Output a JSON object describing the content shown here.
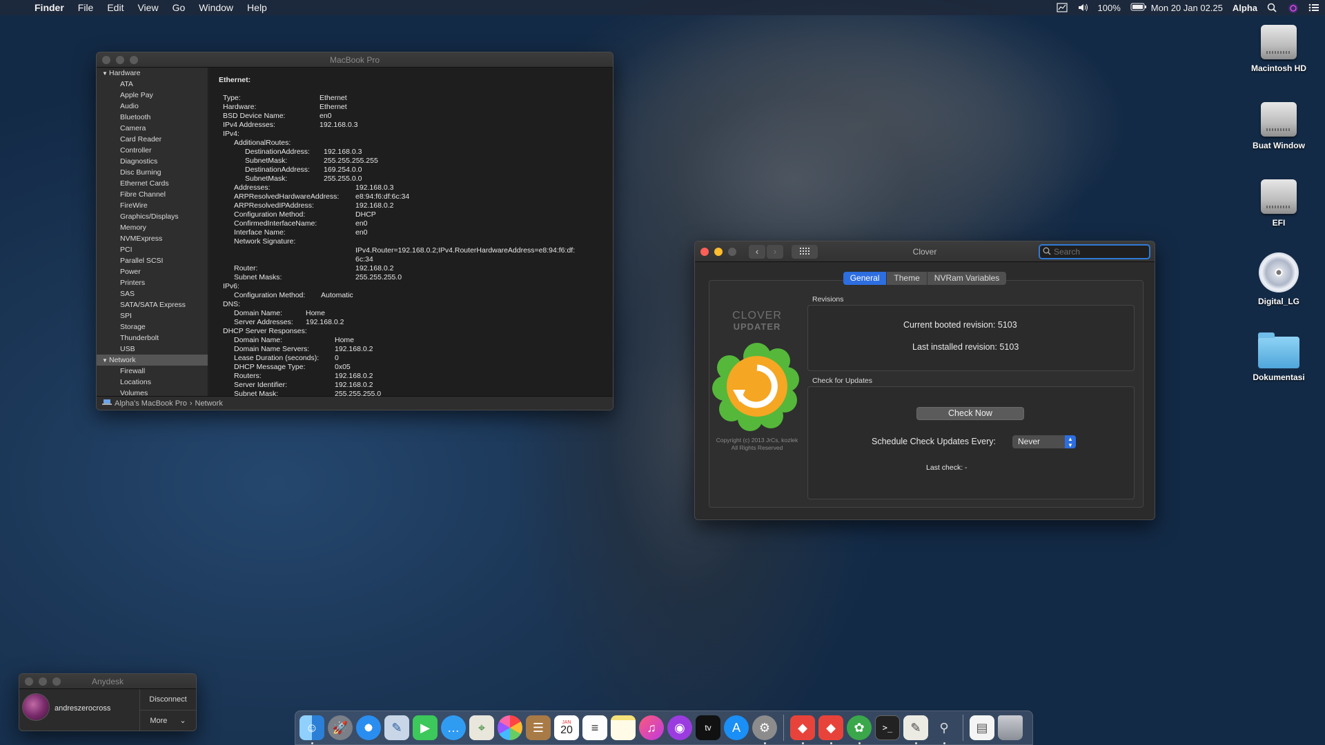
{
  "menubar": {
    "app": "Finder",
    "items": [
      "File",
      "Edit",
      "View",
      "Go",
      "Window",
      "Help"
    ],
    "battery": "100%",
    "datetime": "Mon 20 Jan  02.25",
    "user": "Alpha"
  },
  "desktop": {
    "icons": [
      {
        "label": "Macintosh HD",
        "icon": "hard-drive-icon"
      },
      {
        "label": "Buat Window",
        "icon": "hard-drive-icon"
      },
      {
        "label": "EFI",
        "icon": "hard-drive-icon"
      },
      {
        "label": "Digital_LG",
        "icon": "cd-icon"
      },
      {
        "label": "Dokumentasi",
        "icon": "folder-icon"
      }
    ]
  },
  "sysinfo": {
    "title": "MacBook Pro",
    "sidebar": {
      "hardware_label": "Hardware",
      "hardware_items": [
        "ATA",
        "Apple Pay",
        "Audio",
        "Bluetooth",
        "Camera",
        "Card Reader",
        "Controller",
        "Diagnostics",
        "Disc Burning",
        "Ethernet Cards",
        "Fibre Channel",
        "FireWire",
        "Graphics/Displays",
        "Memory",
        "NVMExpress",
        "PCI",
        "Parallel SCSI",
        "Power",
        "Printers",
        "SAS",
        "SATA/SATA Express",
        "SPI",
        "Storage",
        "Thunderbolt",
        "USB"
      ],
      "network_label": "Network",
      "network_items": [
        "Firewall",
        "Locations",
        "Volumes"
      ]
    },
    "heading": "Ethernet:",
    "rows": [
      {
        "indent": 0,
        "k": "Type:",
        "v": "Ethernet",
        "w": 140
      },
      {
        "indent": 0,
        "k": "Hardware:",
        "v": "Ethernet",
        "w": 140
      },
      {
        "indent": 0,
        "k": "BSD Device Name:",
        "v": "en0",
        "w": 140
      },
      {
        "indent": 0,
        "k": "IPv4 Addresses:",
        "v": "192.168.0.3",
        "w": 140
      },
      {
        "indent": 0,
        "k": "IPv4:",
        "v": "",
        "w": 140
      },
      {
        "indent": 1,
        "k": "AdditionalRoutes:",
        "v": "",
        "w": 140
      },
      {
        "indent": 2,
        "k": "DestinationAddress:",
        "v": "192.168.0.3",
        "w": 114
      },
      {
        "indent": 2,
        "k": "SubnetMask:",
        "v": "255.255.255.255",
        "w": 114
      },
      {
        "indent": 2,
        "k": "DestinationAddress:",
        "v": "169.254.0.0",
        "w": 114
      },
      {
        "indent": 2,
        "k": "SubnetMask:",
        "v": "255.255.0.0",
        "w": 114
      },
      {
        "indent": 1,
        "k": "Addresses:",
        "v": "192.168.0.3",
        "w": 176
      },
      {
        "indent": 1,
        "k": "ARPResolvedHardwareAddress:",
        "v": "e8:94:f6:df:6c:34",
        "w": 176
      },
      {
        "indent": 1,
        "k": "ARPResolvedIPAddress:",
        "v": "192.168.0.2",
        "w": 176
      },
      {
        "indent": 1,
        "k": "Configuration Method:",
        "v": "DHCP",
        "w": 176
      },
      {
        "indent": 1,
        "k": "ConfirmedInterfaceName:",
        "v": "en0",
        "w": 176
      },
      {
        "indent": 1,
        "k": "Interface Name:",
        "v": "en0",
        "w": 176
      },
      {
        "indent": 1,
        "k": "Network Signature:",
        "v": "",
        "w": 176
      },
      {
        "indent": 1,
        "k": "",
        "v": "IPv4.Router=192.168.0.2;IPv4.RouterHardwareAddress=e8:94:f6:df:",
        "w": 176
      },
      {
        "indent": 1,
        "k": "",
        "v": "6c:34",
        "w": 176
      },
      {
        "indent": 1,
        "k": "Router:",
        "v": "192.168.0.2",
        "w": 176
      },
      {
        "indent": 1,
        "k": "Subnet Masks:",
        "v": "255.255.255.0",
        "w": 176
      },
      {
        "indent": 0,
        "k": "IPv6:",
        "v": "",
        "w": 140
      },
      {
        "indent": 1,
        "k": "Configuration Method:",
        "v": "Automatic",
        "w": 126
      },
      {
        "indent": 0,
        "k": "DNS:",
        "v": "",
        "w": 140
      },
      {
        "indent": 1,
        "k": "Domain Name:",
        "v": "Home",
        "w": 104
      },
      {
        "indent": 1,
        "k": "Server Addresses:",
        "v": "192.168.0.2",
        "w": 104
      },
      {
        "indent": 0,
        "k": "DHCP Server Responses:",
        "v": "",
        "w": 140
      },
      {
        "indent": 1,
        "k": "Domain Name:",
        "v": "Home",
        "w": 146
      },
      {
        "indent": 1,
        "k": "Domain Name Servers:",
        "v": "192.168.0.2",
        "w": 146
      },
      {
        "indent": 1,
        "k": "Lease Duration (seconds):",
        "v": "0",
        "w": 146
      },
      {
        "indent": 1,
        "k": "DHCP Message Type:",
        "v": "0x05",
        "w": 146
      },
      {
        "indent": 1,
        "k": "Routers:",
        "v": "192.168.0.2",
        "w": 146
      },
      {
        "indent": 1,
        "k": "Server Identifier:",
        "v": "192.168.0.2",
        "w": 146
      },
      {
        "indent": 1,
        "k": "Subnet Mask:",
        "v": "255.255.255.0",
        "w": 146
      }
    ],
    "path": {
      "machine": "Alpha's MacBook Pro",
      "separator": "›",
      "section": "Network"
    }
  },
  "clover": {
    "title": "Clover",
    "search_placeholder": "Search",
    "tabs": [
      "General",
      "Theme",
      "NVRam Variables"
    ],
    "selected_tab": "General",
    "logo_title": "CLOVER",
    "logo_sub": "UPDATER",
    "copyright_1": "Copyright (c) 2013 JrCs, kozlek",
    "copyright_2": "All Rights Reserved",
    "revisions_label": "Revisions",
    "current_label": "Current booted revision:",
    "current_value": "5103",
    "last_label": "Last installed revision:",
    "last_value": "5103",
    "updates_label": "Check for Updates",
    "check_now": "Check Now",
    "schedule_label": "Schedule Check Updates Every:",
    "schedule_value": "Never",
    "last_check": "Last check: -"
  },
  "anydesk": {
    "title": "Anydesk",
    "user": "andreszerocross",
    "disconnect": "Disconnect",
    "more": "More"
  },
  "dock": {
    "calendar_month": "JAN",
    "calendar_day": "20",
    "tv_label": "tv"
  },
  "colors": {
    "accent": "#2d6ee0",
    "clover_orange": "#f5a623",
    "clover_green": "#55b83a"
  }
}
